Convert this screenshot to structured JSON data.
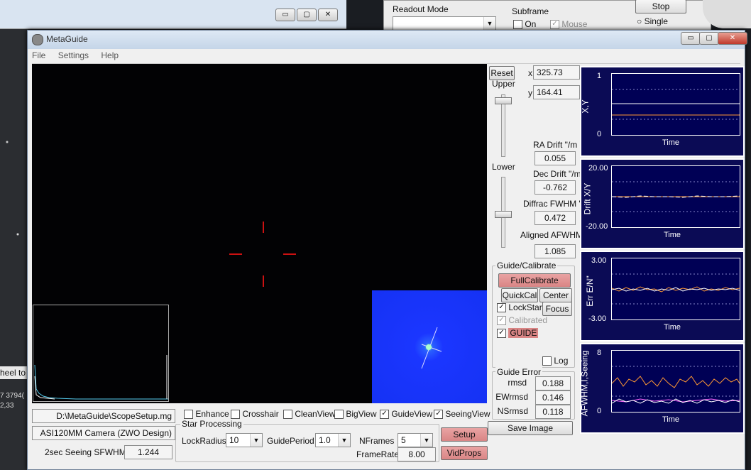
{
  "background": {
    "readout_label": "Readout Mode",
    "subframe_label": "Subframe",
    "subframe_on": "On",
    "subframe_mouse": "Mouse",
    "stop_button": "Stop",
    "single_label": "Single",
    "wheel_text": "heel to",
    "coords_line1": "7 3794(",
    "coords_line2": "2,33"
  },
  "window": {
    "title": "MetaGuide",
    "min_glyph": "▭",
    "max_glyph": "▢",
    "close_glyph": "✕"
  },
  "menu": [
    "File",
    "Settings",
    "Help"
  ],
  "controls": {
    "reset": "Reset",
    "upper": "Upper",
    "lower": "Lower",
    "x_label": "x",
    "x_value": "325.73",
    "y_label": "y",
    "y_value": "164.41",
    "ra_drift_label": "RA Drift \"/m",
    "ra_drift_value": "0.055",
    "dec_drift_label": "Dec Drift \"/m",
    "dec_drift_value": "-0.762",
    "diffrac_label": "Diffrac FWHM \"",
    "diffrac_value": "0.472",
    "aligned_label": "Aligned AFWHM \"",
    "aligned_value": "1.085"
  },
  "guide": {
    "group_label": "Guide/Calibrate",
    "full_calibrate": "FullCalibrate",
    "quickcal": "QuickCal",
    "center": "Center",
    "lockstar": "LockStar",
    "focus": "Focus",
    "calibrated": "Calibrated",
    "guide": "GUIDE",
    "log": "Log"
  },
  "guide_error": {
    "group_label": "Guide Error",
    "rmsd_label": "rmsd",
    "rmsd_value": "0.188",
    "ew_label": "EWrmsd",
    "ew_value": "0.146",
    "ns_label": "NSrmsd",
    "ns_value": "0.118",
    "save_image": "Save Image"
  },
  "bottom": {
    "script_path": "D:\\MetaGuide\\ScopeSetup.mg",
    "camera": "ASI120MM Camera (ZWO Design)",
    "seeing_label": "2sec Seeing SFWHM\"",
    "seeing_value": "1.244",
    "enhance": "Enhance",
    "crosshair": "Crosshair",
    "cleanview": "CleanView",
    "bigview": "BigView",
    "guideview": "GuideView",
    "seeingview": "SeeingView",
    "star_processing": "Star Processing",
    "lockradius_label": "LockRadius",
    "lockradius_value": "10",
    "guideperiod_label": "GuidePeriod",
    "guideperiod_value": "1.0",
    "nframes_label": "NFrames",
    "nframes_value": "5",
    "framerate_label": "FrameRate",
    "framerate_value": "8.00",
    "setup": "Setup",
    "vidprops": "VidProps"
  },
  "plots": [
    {
      "ylabel": "X,Y",
      "xlabel": "Time",
      "ymax": "1",
      "ymin": "0"
    },
    {
      "ylabel": "Drift X/Y",
      "xlabel": "Time",
      "ymax": "20.00",
      "ymin": "-20.00"
    },
    {
      "ylabel": "Err E/N\"",
      "xlabel": "Time",
      "ymax": "3.00",
      "ymin": "-3.00"
    },
    {
      "ylabel": "AFWHM,I,Seeing",
      "xlabel": "Time",
      "ymax": "8",
      "ymin": "0"
    }
  ],
  "colors": {
    "plot_bg": "#000055",
    "trace_orange": "#ff9933",
    "trace_white": "#ffffff",
    "trace_magenta": "#ff66ff",
    "button_red": "#d98585",
    "crosshair": "#cc1111",
    "histogram": "#55ccee"
  }
}
